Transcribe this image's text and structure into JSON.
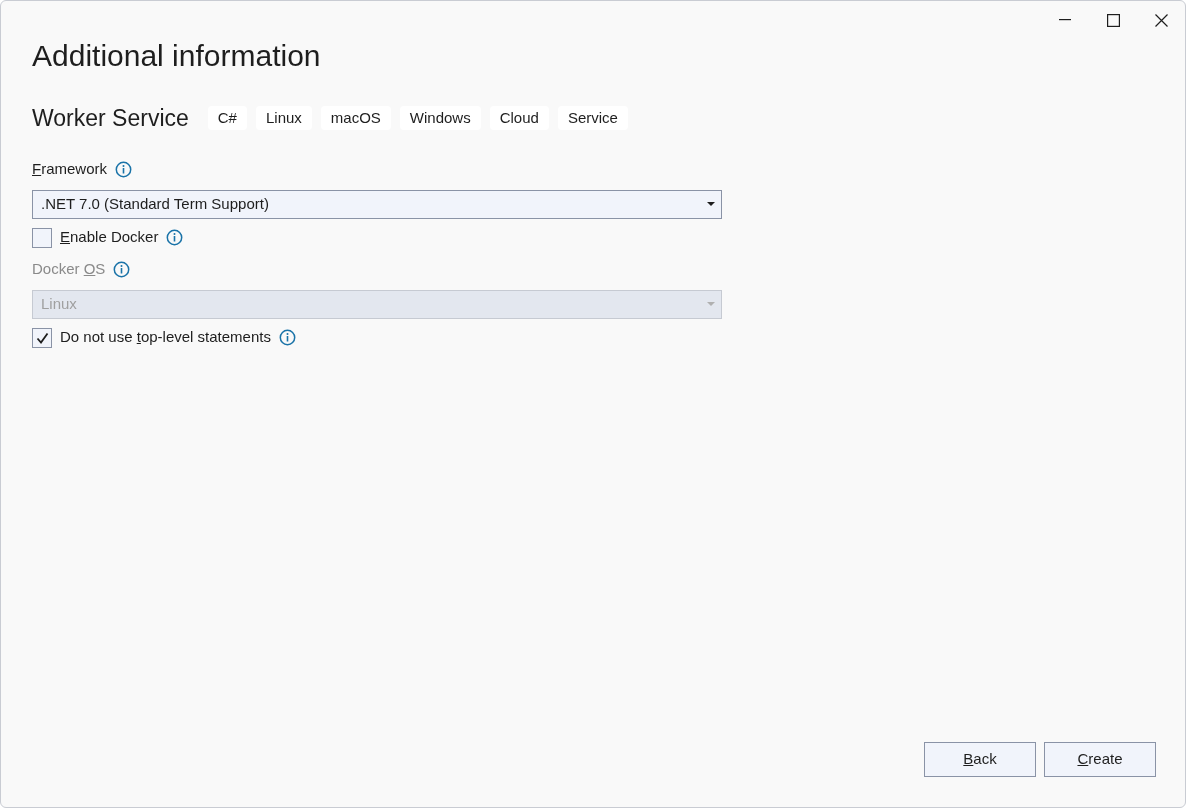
{
  "window": {
    "title": "Additional information"
  },
  "template": {
    "name": "Worker Service",
    "tags": [
      "C#",
      "Linux",
      "macOS",
      "Windows",
      "Cloud",
      "Service"
    ]
  },
  "fields": [
    {
      "kind": "label",
      "label": {
        "key": "F",
        "after": "ramework"
      },
      "disabled": false
    },
    {
      "kind": "dropdown",
      "value": ".NET 7.0 (Standard Term Support)",
      "disabled": false
    },
    {
      "kind": "checkbox",
      "label": {
        "key": "E",
        "after": "nable Docker"
      },
      "checked": false
    },
    {
      "kind": "label",
      "label": {
        "before": "Docker ",
        "key": "O",
        "after": "S"
      },
      "disabled": true
    },
    {
      "kind": "dropdown",
      "value": "Linux",
      "disabled": true
    },
    {
      "kind": "checkbox",
      "label": {
        "before": "Do not use ",
        "key": "t",
        "after": "op-level statements"
      },
      "checked": true
    }
  ],
  "buttons": [
    {
      "label": {
        "key": "B",
        "after": "ack"
      }
    },
    {
      "label": {
        "key": "C",
        "after": "reate"
      }
    }
  ]
}
